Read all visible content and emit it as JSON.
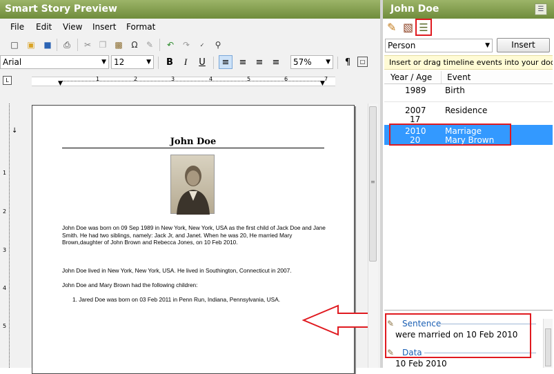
{
  "left_title": "Smart Story Preview",
  "menu": [
    "File",
    "Edit",
    "View",
    "Insert",
    "Format"
  ],
  "font_name": "Arial",
  "font_size": "12",
  "zoom": "57%",
  "ruler_marks": [
    "1",
    "2",
    "3",
    "4",
    "5",
    "6",
    "7"
  ],
  "vruler_marks": [
    "1",
    "2",
    "3",
    "4",
    "5"
  ],
  "document": {
    "heading": "John Doe",
    "para1": "John Doe was born on 09 Sep 1989 in New York, New York, USA as the first child of Jack Doe and Jane Smith. He had two siblings, namely: Jack Jr, and Janet. When he was 20, He married Mary Brown,daughter of John Brown and Rebecca Jones, on 10 Feb 2010.",
    "para2": "John Doe lived in New York, New York, USA. He lived in Southington, Connecticut in 2007.",
    "para3": "John Doe and Mary Brown had the following children:",
    "list_item": "1.   Jared Doe was born on 03 Feb 2011 in Penn Run, Indiana, Pennsylvania, USA."
  },
  "right_title": "John Doe",
  "person_select": "Person",
  "insert_button": "Insert",
  "hint": "Insert or drag timeline events into your document",
  "timeline_headers": [
    "Year / Age",
    "Event"
  ],
  "timeline": [
    {
      "year": "1989",
      "age": "",
      "event": "Birth",
      "detail": ""
    },
    {
      "year": "2007",
      "age": "17",
      "event": "Residence",
      "detail": ""
    },
    {
      "year": "2010",
      "age": "20",
      "event": "Marriage",
      "detail": "Mary Brown"
    }
  ],
  "sentence_label": "Sentence",
  "sentence_text": "were married on 10 Feb 2010",
  "data_label": "Data",
  "data_text": "10 Feb 2010",
  "colors": {
    "titlebar": "#7f9b4a",
    "selection": "#3399ff",
    "highlight": "#e0191f",
    "hint_bg": "#fffbd5",
    "section_label": "#1a5fb4"
  }
}
